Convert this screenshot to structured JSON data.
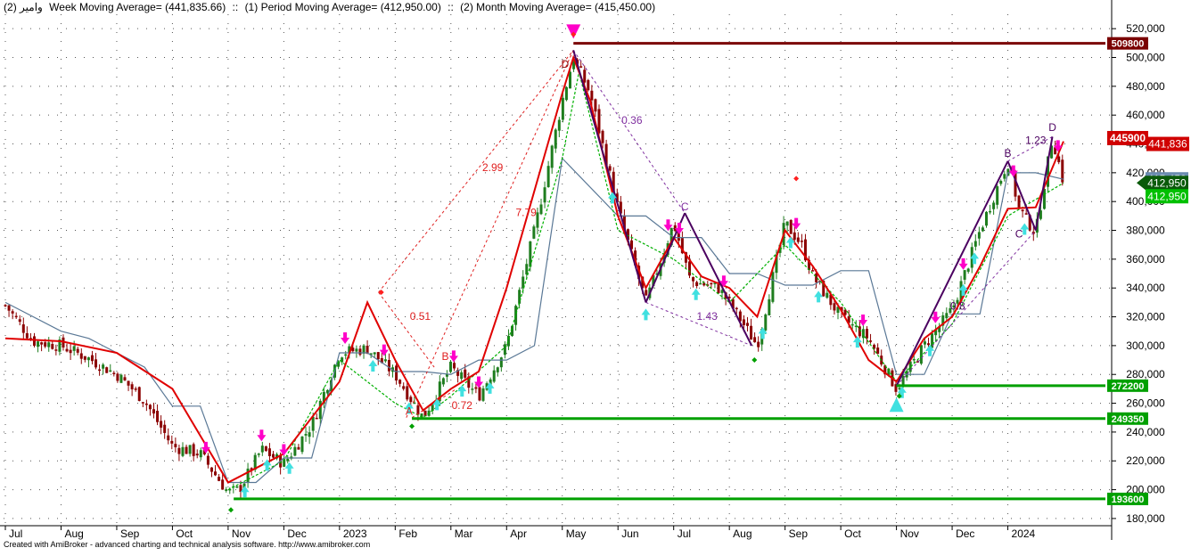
{
  "header": {
    "symbol": "وامیر",
    "week_ma": "(2) Week Moving Average= (441,835.66)",
    "sep1": "::",
    "period_ma": "(1) Period Moving Average= (412,950.00)",
    "sep2": "::",
    "month_ma": "(2) Month Moving Average= (415,450.00)"
  },
  "footer": "Created with AmiBroker - advanced charting and technical analysis software. http://www.amibroker.com",
  "colors": {
    "candle_up": "#1e7d1e",
    "candle_down": "#8b0000",
    "ma_red": "#e00000",
    "ma_green": "#00b000",
    "ma_steel": "#5a7896",
    "resistance": "#7a0000",
    "support": "#00a000",
    "pattern": "#4b0060",
    "buy_arrow": "#40e0e0",
    "sell_arrow": "#ff00c8"
  },
  "chart_data": {
    "type": "line",
    "title": "",
    "ylim": [
      175000,
      530000
    ],
    "yticks": [
      180000,
      200000,
      220000,
      240000,
      260000,
      280000,
      300000,
      320000,
      340000,
      360000,
      380000,
      400000,
      420000,
      440000,
      460000,
      480000,
      500000,
      520000
    ],
    "ytick_labels": [
      "180,000",
      "200,000",
      "220,000",
      "240,000",
      "260,000",
      "280,000",
      "300,000",
      "320,000",
      "340,000",
      "360,000",
      "380,000",
      "400,000",
      "420,000",
      "440,000",
      "460,000",
      "480,000",
      "500,000",
      "520,000"
    ],
    "x_labels": [
      "Jul",
      "Aug",
      "Sep",
      "Oct",
      "Nov",
      "Dec",
      "2023",
      "Feb",
      "Mar",
      "Apr",
      "May",
      "Jun",
      "Jul",
      "Aug",
      "Sep",
      "Oct",
      "Nov",
      "Dec",
      "2024"
    ],
    "x_label_pos": [
      0,
      1,
      2,
      3,
      4,
      5,
      6,
      7,
      8,
      9,
      10,
      11,
      12,
      13,
      14,
      15,
      16,
      17,
      18
    ],
    "x_max": 19.8,
    "grid": true,
    "price": {
      "x": [
        0,
        0.5,
        1,
        1.5,
        2,
        2.5,
        3,
        3.5,
        4,
        4.2,
        4.6,
        5,
        5.5,
        6,
        6.5,
        7,
        7.5,
        8,
        8.5,
        9,
        9.5,
        10,
        10.2,
        10.5,
        11,
        11.5,
        12,
        12.3,
        12.8,
        13,
        13.5,
        14,
        14.3,
        14.5,
        15,
        15.5,
        16,
        16.5,
        17,
        17.5,
        18,
        18.2,
        18.5,
        18.8,
        19
      ],
      "y": [
        328000,
        303000,
        300000,
        291000,
        280000,
        262000,
        230000,
        225000,
        198000,
        200000,
        228000,
        218000,
        245000,
        295000,
        298000,
        280000,
        250000,
        285000,
        265000,
        300000,
        380000,
        470000,
        500000,
        475000,
        395000,
        330000,
        385000,
        345000,
        340000,
        330000,
        300000,
        385000,
        370000,
        348000,
        320000,
        305000,
        270000,
        300000,
        325000,
        380000,
        428000,
        395000,
        378000,
        445000,
        412950
      ]
    },
    "red_ma": {
      "x": [
        0,
        1,
        2,
        3,
        4,
        5,
        6,
        6.5,
        7,
        7.5,
        8,
        8.5,
        9,
        10,
        10.2,
        10.5,
        11,
        11.5,
        12,
        12.5,
        13,
        13.5,
        14,
        14.5,
        15,
        15.5,
        16,
        16.5,
        17,
        17.5,
        18,
        18.5,
        19
      ],
      "y": [
        305000,
        303000,
        295000,
        270000,
        205000,
        225000,
        275000,
        330000,
        290000,
        255000,
        270000,
        282000,
        340000,
        475000,
        500000,
        470000,
        390000,
        340000,
        375000,
        348000,
        340000,
        320000,
        380000,
        355000,
        325000,
        290000,
        275000,
        305000,
        320000,
        355000,
        395000,
        396000,
        441836
      ]
    },
    "steel_ma": {
      "x": [
        0,
        1,
        1.5,
        2,
        2.5,
        3,
        3.5,
        4,
        4.5,
        5,
        5.5,
        6,
        6.5,
        7,
        7.5,
        8,
        8.5,
        9,
        9.5,
        10,
        11,
        11.5,
        12,
        12.5,
        13,
        13.5,
        14,
        14.5,
        15,
        15.5,
        16,
        16.5,
        17,
        17.5,
        18,
        18.5,
        19
      ],
      "y": [
        330000,
        310000,
        305000,
        295000,
        285000,
        258000,
        258000,
        205000,
        205000,
        222000,
        222000,
        295000,
        295000,
        282000,
        282000,
        280000,
        290000,
        290000,
        300000,
        430000,
        390000,
        390000,
        375000,
        375000,
        350000,
        350000,
        342000,
        342000,
        352000,
        352000,
        280000,
        280000,
        322000,
        322000,
        420000,
        420000,
        415450
      ]
    },
    "green_ma": {
      "x": [
        4,
        5,
        6,
        7,
        7.5,
        8,
        9,
        10,
        10.3,
        11,
        12,
        13,
        14,
        15,
        16,
        17,
        18,
        19
      ],
      "y": [
        200000,
        220000,
        290000,
        260000,
        250000,
        265000,
        300000,
        430000,
        490000,
        380000,
        360000,
        330000,
        370000,
        330000,
        275000,
        315000,
        390000,
        412950
      ]
    },
    "levels": [
      {
        "label": "509800",
        "value": 509800,
        "x_from": 10.2,
        "kind": "resistance"
      },
      {
        "label": "272200",
        "value": 272200,
        "x_from": 16,
        "kind": "support"
      },
      {
        "label": "249350",
        "value": 249350,
        "x_from": 7.3,
        "kind": "support"
      },
      {
        "label": "193600",
        "value": 193600,
        "x_from": 4.1,
        "kind": "support"
      }
    ],
    "price_tags": [
      {
        "label": "445900",
        "value": 445900,
        "color": "#d00000"
      },
      {
        "label": "441,836",
        "value": 441836,
        "color": "#d00000"
      },
      {
        "label": "415,450",
        "value": 415450,
        "color": "#6b8cb0"
      },
      {
        "label": "412,950",
        "value": 412950,
        "color": "#0a5a0a"
      },
      {
        "label": "412,950",
        "value": 412950,
        "color": "#00c000",
        "offset": 1
      }
    ],
    "pattern_lines": [
      {
        "x": [
          10.2,
          11.5
        ],
        "y": [
          505000,
          330000
        ]
      },
      {
        "x": [
          11.5,
          12.2
        ],
        "y": [
          330000,
          392000
        ]
      },
      {
        "x": [
          12.2,
          13.4
        ],
        "y": [
          392000,
          300000
        ]
      },
      {
        "x": [
          16,
          18
        ],
        "y": [
          272000,
          428000
        ]
      },
      {
        "x": [
          18,
          18.5
        ],
        "y": [
          428000,
          380000
        ]
      },
      {
        "x": [
          18.5,
          18.8
        ],
        "y": [
          380000,
          445000
        ]
      }
    ],
    "dashed_lines": [
      {
        "x": [
          7.2,
          10.2
        ],
        "y": [
          250000,
          505000
        ],
        "color": "#e02020"
      },
      {
        "x": [
          6.7,
          10.2
        ],
        "y": [
          337000,
          505000
        ],
        "color": "#e02020"
      },
      {
        "x": [
          6.7,
          7.7
        ],
        "y": [
          337000,
          285000
        ],
        "color": "#e02020"
      },
      {
        "x": [
          7.3,
          8.1
        ],
        "y": [
          250000,
          270000
        ],
        "color": "#e02020"
      },
      {
        "x": [
          10.2,
          12.2
        ],
        "y": [
          505000,
          392000
        ],
        "color": "#8030a0"
      },
      {
        "x": [
          11.5,
          13.4
        ],
        "y": [
          330000,
          300000
        ],
        "color": "#8030a0"
      },
      {
        "x": [
          16,
          18.5
        ],
        "y": [
          272000,
          380000
        ],
        "color": "#8030a0"
      },
      {
        "x": [
          18,
          18.8
        ],
        "y": [
          428000,
          445000
        ],
        "color": "#8030a0"
      }
    ],
    "annotations": [
      {
        "text": "2.99",
        "x": 8.75,
        "y": 421000,
        "color": "#e02020"
      },
      {
        "text": "7.79",
        "x": 9.35,
        "y": 390000,
        "color": "#e02020"
      },
      {
        "text": "0.51",
        "x": 7.45,
        "y": 318000,
        "color": "#e02020"
      },
      {
        "text": "0.72",
        "x": 8.2,
        "y": 256000,
        "color": "#e02020"
      },
      {
        "text": "B",
        "x": 7.9,
        "y": 290000,
        "color": "#e02020"
      },
      {
        "text": "A",
        "x": 7.25,
        "y": 252000,
        "color": "#e02020"
      },
      {
        "text": "D",
        "x": 10.05,
        "y": 493000,
        "color": "#8b0000"
      },
      {
        "text": "0.36",
        "x": 11.25,
        "y": 454000,
        "color": "#8030a0"
      },
      {
        "text": "C",
        "x": 12.2,
        "y": 394000,
        "color": "#8030a0"
      },
      {
        "text": "1.43",
        "x": 12.6,
        "y": 318000,
        "color": "#8030a0"
      },
      {
        "text": "B",
        "x": 18,
        "y": 431000,
        "color": "#4b0060"
      },
      {
        "text": "D",
        "x": 18.8,
        "y": 449000,
        "color": "#4b0060"
      },
      {
        "text": "1.23",
        "x": 18.5,
        "y": 440000,
        "color": "#4b0060"
      },
      {
        "text": "C",
        "x": 18.2,
        "y": 375000,
        "color": "#4b0060"
      },
      {
        "text": "0.8",
        "x": 17.1,
        "y": 325000,
        "color": "#4b0060"
      }
    ]
  }
}
